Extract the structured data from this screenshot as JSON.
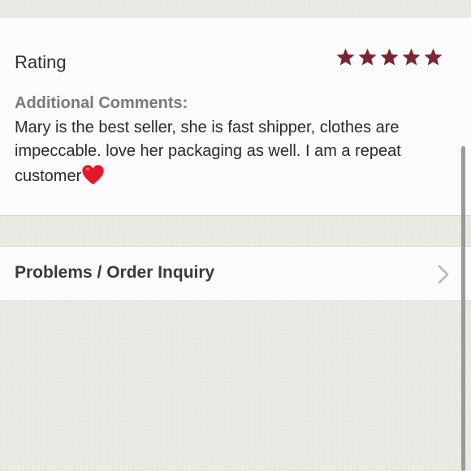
{
  "rating_section": {
    "label": "Rating",
    "stars": 5,
    "star_color": "#7a2535",
    "comments_label": "Additional Comments:",
    "comments_text": "Mary is the best seller, she is fast shipper, clothes are impeccable. love her packaging as well. I am a repeat customer",
    "trailing_emoji": "heart-emoji"
  },
  "inquiry_row": {
    "label": "Problems / Order Inquiry",
    "icon": "chevron-right-icon"
  },
  "colors": {
    "background": "#ebe9e4",
    "card": "#fcfbfc",
    "star": "#7a2535"
  }
}
